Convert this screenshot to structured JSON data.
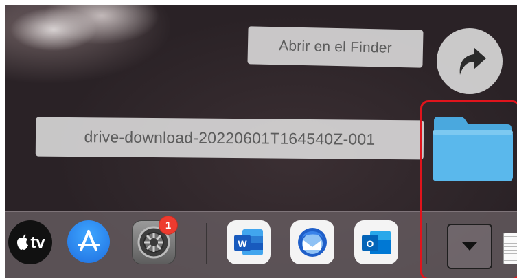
{
  "desktop": {
    "finder_tooltip": "Abrir en el Finder",
    "folder_name": "drive-download-20220601T164540Z-001"
  },
  "icons": {
    "open_in_finder": "curved-arrow-icon",
    "folder": "folder-icon"
  },
  "dock": {
    "items": [
      {
        "name": "Apple TV",
        "label": "tv",
        "icon": "apple-tv-icon"
      },
      {
        "name": "App Store",
        "icon": "app-store-icon"
      },
      {
        "name": "System Preferences",
        "icon": "gear-icon",
        "badge": "1"
      },
      {
        "name": "Microsoft Word",
        "label": "W",
        "icon": "word-icon"
      },
      {
        "name": "Thunderbird",
        "icon": "thunderbird-icon"
      },
      {
        "name": "Microsoft Outlook",
        "label": "O",
        "icon": "outlook-icon"
      }
    ],
    "stack_expand_icon": "caret-down-icon",
    "document_icon": "document-icon"
  },
  "colors": {
    "highlight": "#e0141c",
    "folder": "#5ab8ec",
    "badge": "#ee3b2f"
  }
}
